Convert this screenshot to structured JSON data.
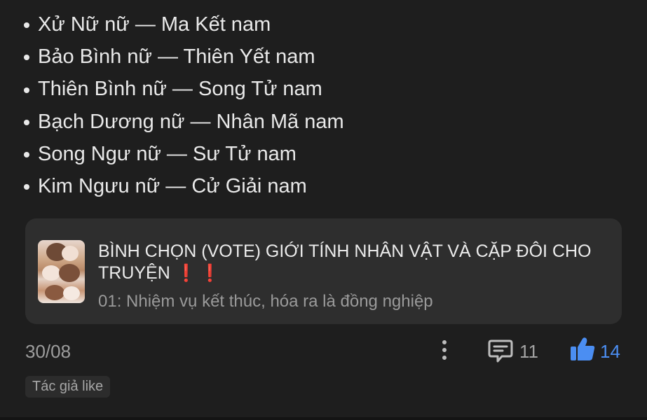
{
  "pairs": [
    "Xử Nữ nữ — Ma Kết nam",
    "Bảo Bình nữ — Thiên Yết nam",
    "Thiên Bình nữ — Song Tử nam",
    "Bạch Dương nữ — Nhân Mã nam",
    "Song Ngư nữ — Sư Tử nam",
    "Kim Ngưu nữ — Cử Giải nam"
  ],
  "card": {
    "title": "BÌNH CHỌN (VOTE) GIỚI TÍNH NHÂN VẬT VÀ CẶP ĐÔI CHO TRUYỆN",
    "exclaim": "❗❗",
    "subtitle": "01: Nhiệm vụ kết thúc, hóa ra là đồng nghiệp",
    "thumbnail_icon": "story-cover-image"
  },
  "footer": {
    "date": "30/08",
    "more_icon": "more-vertical-icon",
    "comment_icon": "comment-icon",
    "comment_count": "11",
    "like_icon": "thumbs-up-icon",
    "like_count": "14",
    "tag": "Tác giả like"
  },
  "colors": {
    "background": "#1e1e1e",
    "card": "#2e2e2e",
    "like_accent": "#4b8ef2",
    "exclaim": "#e0202b"
  }
}
